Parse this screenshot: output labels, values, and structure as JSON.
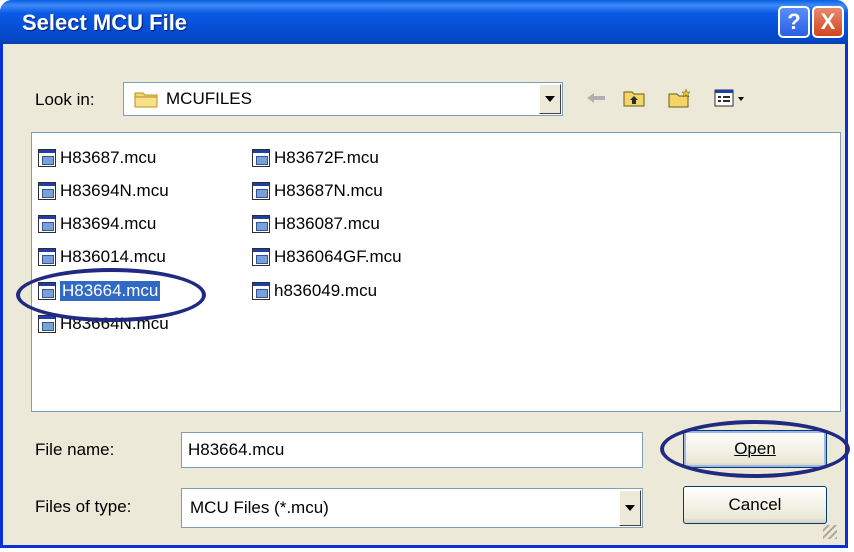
{
  "window": {
    "title": "Select MCU File",
    "help_label": "?",
    "close_label": "X"
  },
  "lookin": {
    "label": "Look in:",
    "value": "MCUFILES"
  },
  "toolbar": {
    "icons": [
      "back-arrow-icon",
      "up-folder-icon",
      "new-folder-icon",
      "view-menu-icon"
    ]
  },
  "files": [
    {
      "name": "H83687.mcu"
    },
    {
      "name": "H83694N.mcu"
    },
    {
      "name": "H83694.mcu"
    },
    {
      "name": "H836014.mcu"
    },
    {
      "name": "H83664.mcu",
      "selected": true
    },
    {
      "name": "H83664N.mcu"
    },
    {
      "name": "H83672F.mcu"
    },
    {
      "name": "H83687N.mcu"
    },
    {
      "name": "H836087.mcu"
    },
    {
      "name": "H836064GF.mcu"
    },
    {
      "name": "h836049.mcu"
    }
  ],
  "filename": {
    "label": "File name:",
    "value": "H83664.mcu"
  },
  "filetype": {
    "label": "Files of type:",
    "value": "MCU Files (*.mcu)"
  },
  "buttons": {
    "open": "Open",
    "cancel": "Cancel"
  },
  "colors": {
    "titlebar": "#0a5fe0",
    "selection": "#316ac5",
    "annotation": "#1f2a80"
  }
}
